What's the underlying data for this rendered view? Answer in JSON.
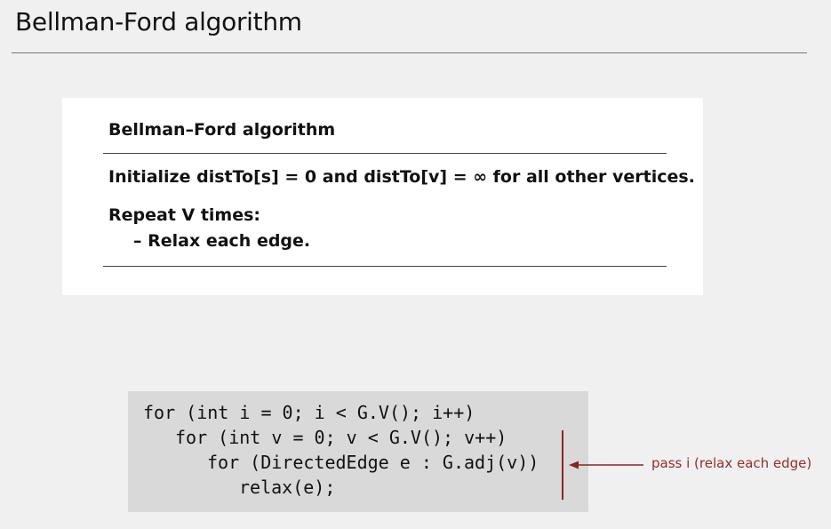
{
  "slide": {
    "title": "Bellman-Ford algorithm"
  },
  "algorithm_box": {
    "heading": "Bellman–Ford algorithm",
    "lines": [
      "Initialize distTo[s] = 0 and distTo[v] = ∞ for all other vertices.",
      "Repeat V times:",
      "– Relax each edge."
    ]
  },
  "code": {
    "lines": [
      "for (int i = 0; i < G.V(); i++)",
      "for (int v = 0; v < G.V(); v++)",
      "for (DirectedEdge e : G.adj(v))",
      "relax(e);"
    ]
  },
  "annotation": {
    "label": "pass i (relax each edge)",
    "color": "#9a2a2a"
  }
}
